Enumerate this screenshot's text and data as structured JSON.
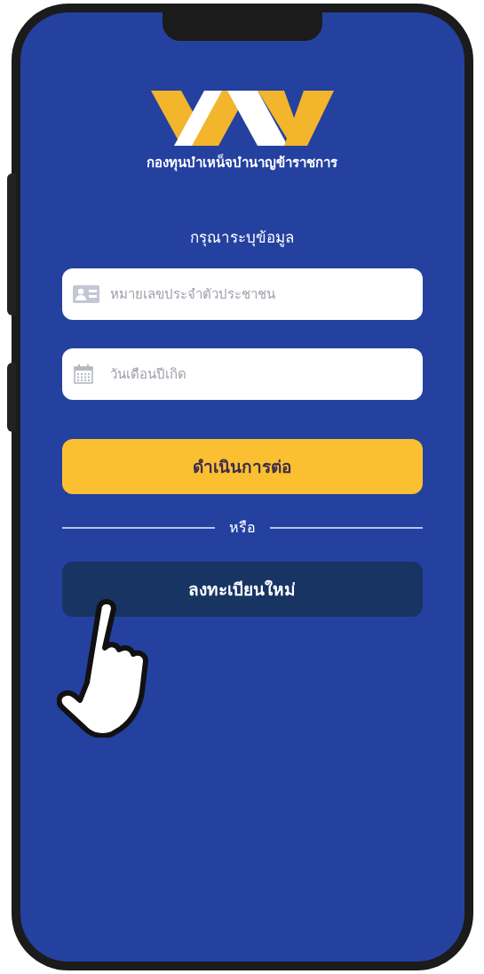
{
  "app": {
    "org_name": "กองทุนบำเหน็จบำนาญข้าราชการ",
    "heading": "กรุณาระบุข้อมูล"
  },
  "fields": [
    {
      "kind": "id-card",
      "placeholder": "หมายเลขประจำตัวประชาชน"
    },
    {
      "kind": "calendar",
      "placeholder": "วันเดือนปีเกิด"
    }
  ],
  "continue_button": "ดำเนินการต่อ",
  "divider_label": "หรือ",
  "register_button": "ลงทะเบียนใหม่"
}
